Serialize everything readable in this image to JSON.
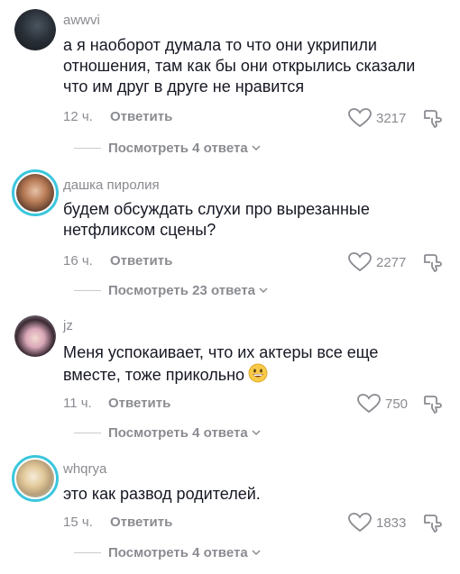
{
  "reply_label": "Ответить",
  "comments": [
    {
      "username": "awwvi",
      "text": "а я наоборот думала то что они укрипили отношения, там как бы они открылись сказали что им друг в друге не нравится",
      "time": "12 ч.",
      "likes": "3217",
      "replies": "Посмотреть 4 ответа",
      "avatar_ring": false
    },
    {
      "username": "дашка пиролия",
      "text": "будем обсуждать слухи про вырезанные нетфликсом сцены?",
      "time": "16 ч.",
      "likes": "2277",
      "replies": "Посмотреть 23 ответа",
      "avatar_ring": true
    },
    {
      "username": "jz",
      "text": "Меня успокаивает, что их актеры все еще вместе, тоже прикольно",
      "emoji": "grinning-face",
      "time": "11 ч.",
      "likes": "750",
      "replies": "Посмотреть 4 ответа",
      "avatar_ring": false
    },
    {
      "username": "whqrya",
      "text": "это как развод родителей.",
      "time": "15 ч.",
      "likes": "1833",
      "replies": "Посмотреть 4 ответа",
      "avatar_ring": true
    }
  ],
  "colors": {
    "accent_ring": "#3bc6dd",
    "muted": "#8a8b91",
    "text": "#161823"
  }
}
